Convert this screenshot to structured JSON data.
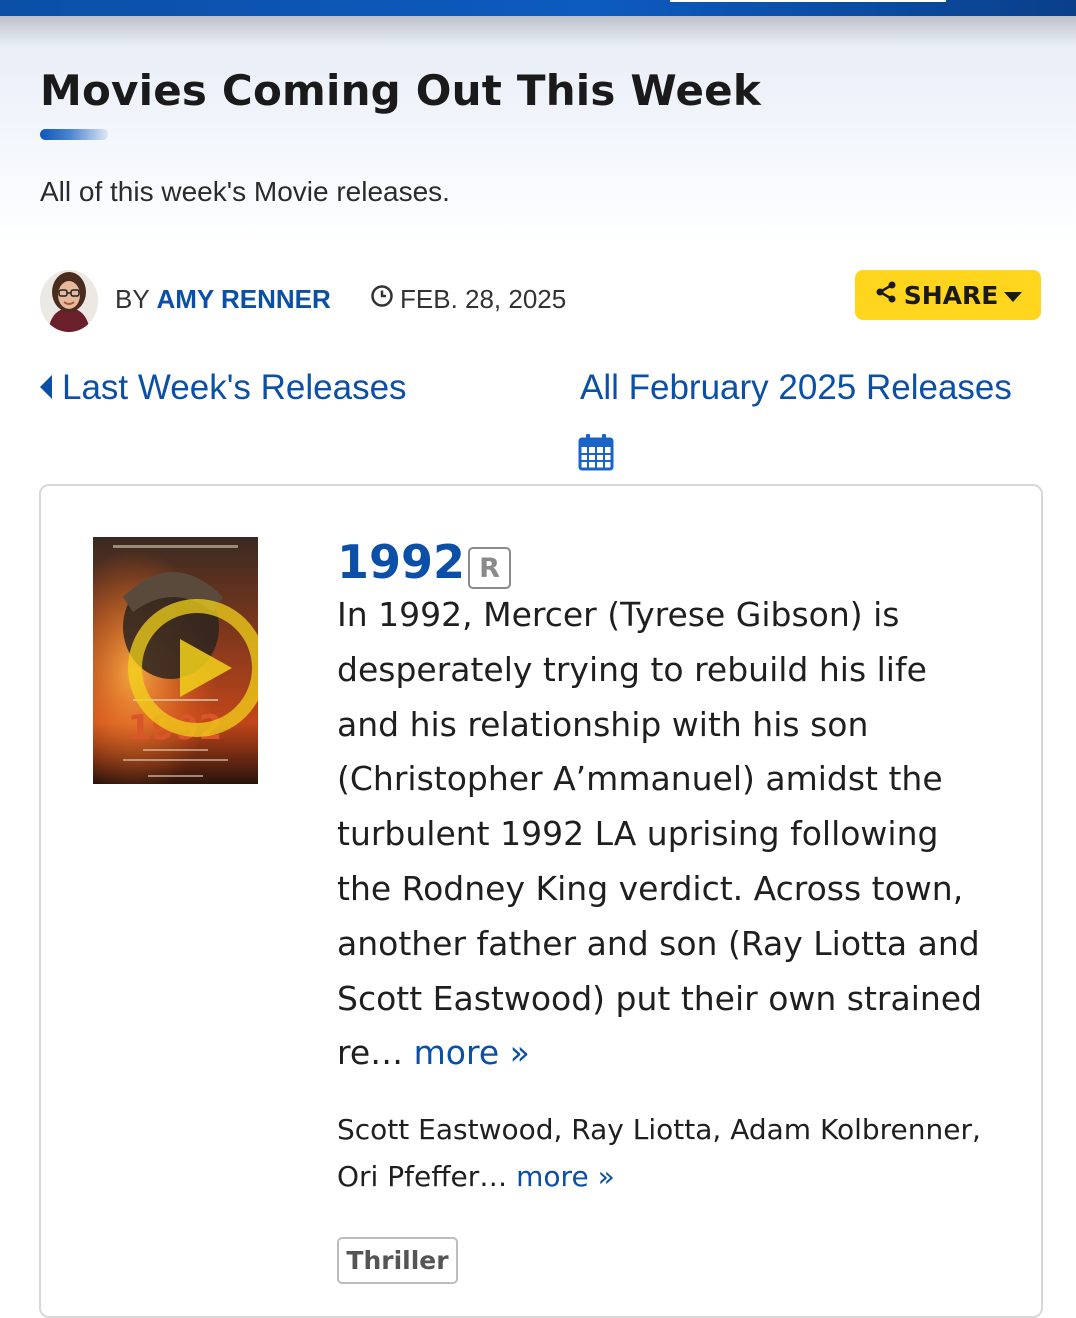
{
  "header": {
    "title": "Movies Coming Out This Week",
    "subtitle": "All of this week's Movie releases."
  },
  "byline": {
    "by": "BY",
    "author": "AMY RENNER",
    "date": "FEB. 28, 2025",
    "share_label": "SHARE"
  },
  "navigation": {
    "prev_label": "Last Week's Releases",
    "all_label": "All February 2025 Releases"
  },
  "movie": {
    "title": "1992",
    "rating": "R",
    "synopsis": "In 1992, Mercer (Tyrese Gibson) is desperately trying to rebuild his life and his relationship with his son (Christopher A’mmanuel) amidst the turbulent 1992 LA uprising following the Rodney King verdict. Across town, another father and son (Ray Liotta and Scott Eastwood) put their own strained re…",
    "synopsis_more": "more »",
    "cast": "Scott Eastwood, Ray Liotta, Adam Kolbrenner, Ori Pfeffer…",
    "cast_more": "more »",
    "genre": "Thriller",
    "poster_text": "1992"
  },
  "colors": {
    "brand_blue": "#0b4fa6",
    "share_yellow": "#ffd51e",
    "play_yellow": "#f2d21b"
  },
  "icons": [
    "clock-icon",
    "share-icon",
    "caret-down-icon",
    "caret-left-icon",
    "calendar-icon",
    "play-icon"
  ]
}
